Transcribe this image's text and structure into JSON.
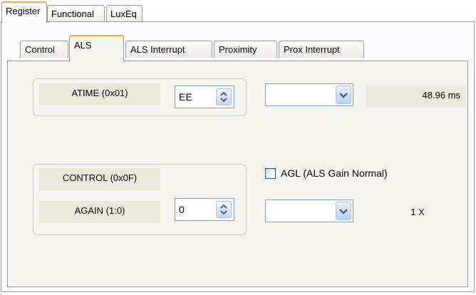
{
  "outer_tabs": [
    {
      "label": "Register",
      "active": true
    },
    {
      "label": "Functional",
      "active": false
    },
    {
      "label": "LuxEq",
      "active": false
    }
  ],
  "inner_tabs": [
    {
      "label": "Control",
      "active": false
    },
    {
      "label": "ALS",
      "active": true
    },
    {
      "label": "ALS Interrupt",
      "active": false
    },
    {
      "label": "Proximity",
      "active": false
    },
    {
      "label": "Prox Interrupt",
      "active": false
    }
  ],
  "atime": {
    "label": "ATIME (0x01)",
    "value": "EE",
    "combo_value": "",
    "readout": "48.96 ms"
  },
  "control": {
    "label": "CONTROL (0x0F)",
    "again_label": "AGAIN (1:0)",
    "again_value": "0",
    "agl_label": "AGL (ALS Gain Normal)",
    "agl_checked": false,
    "combo_value": "",
    "gain_readout": "1 X"
  },
  "icons": {
    "spinner": "up-down-arrows-icon",
    "dropdown": "chevron-down-icon"
  },
  "colors": {
    "accent_tab": "#f9a53a",
    "panel_bg": "#f5f4ef",
    "label_bg": "#ebe9dc",
    "control_border": "#7f9db9"
  }
}
